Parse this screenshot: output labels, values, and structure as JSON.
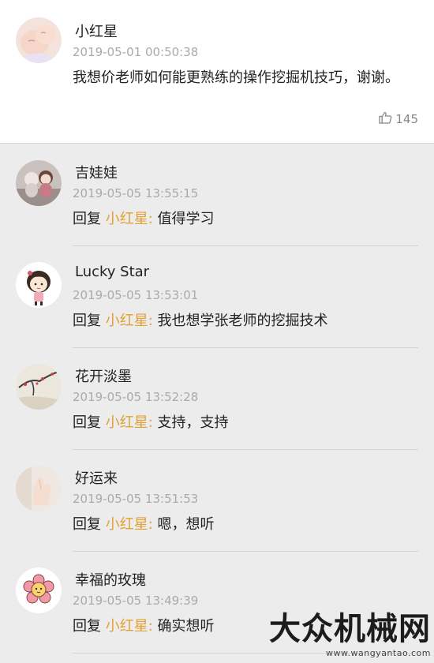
{
  "main_comment": {
    "avatar_icon": "baby-face-photo-avatar",
    "author": "小红星",
    "time": "2019-05-01 00:50:38",
    "content": "我想价老师如何能更熟练的操作挖掘机技巧，谢谢。",
    "likes": "145",
    "like_icon": "thumbs-up-icon"
  },
  "replies": [
    {
      "author": "吉娃娃",
      "time": "2019-05-05 13:55:15",
      "prefix": "回复",
      "target": "小红星:",
      "message": "值得学习",
      "avatar_icon": "dolls-photo-avatar"
    },
    {
      "author": "Lucky Star",
      "time": "2019-05-05 13:53:01",
      "prefix": "回复",
      "target": "小红星:",
      "message": "我也想学张老师的挖掘技术",
      "avatar_icon": "cartoon-girl-avatar"
    },
    {
      "author": "花开淡墨",
      "time": "2019-05-05 13:52:28",
      "prefix": "回复",
      "target": "小红星:",
      "message": "支持，支持",
      "avatar_icon": "ink-painting-avatar"
    },
    {
      "author": "好运来",
      "time": "2019-05-05 13:51:53",
      "prefix": "回复",
      "target": "小红星:",
      "message": "嗯，想听",
      "avatar_icon": "hand-photo-avatar"
    },
    {
      "author": "幸福的玫瑰",
      "time": "2019-05-05 13:49:39",
      "prefix": "回复",
      "target": "小红星:",
      "message": "确实想听",
      "avatar_icon": "cartoon-flower-avatar"
    }
  ],
  "watermark": {
    "title": "大众机械网",
    "url": "www.wangyantao.com"
  },
  "colors": {
    "reply_target": "#e3a033",
    "timestamp": "#aaaaaa",
    "reply_background": "#ececec"
  }
}
